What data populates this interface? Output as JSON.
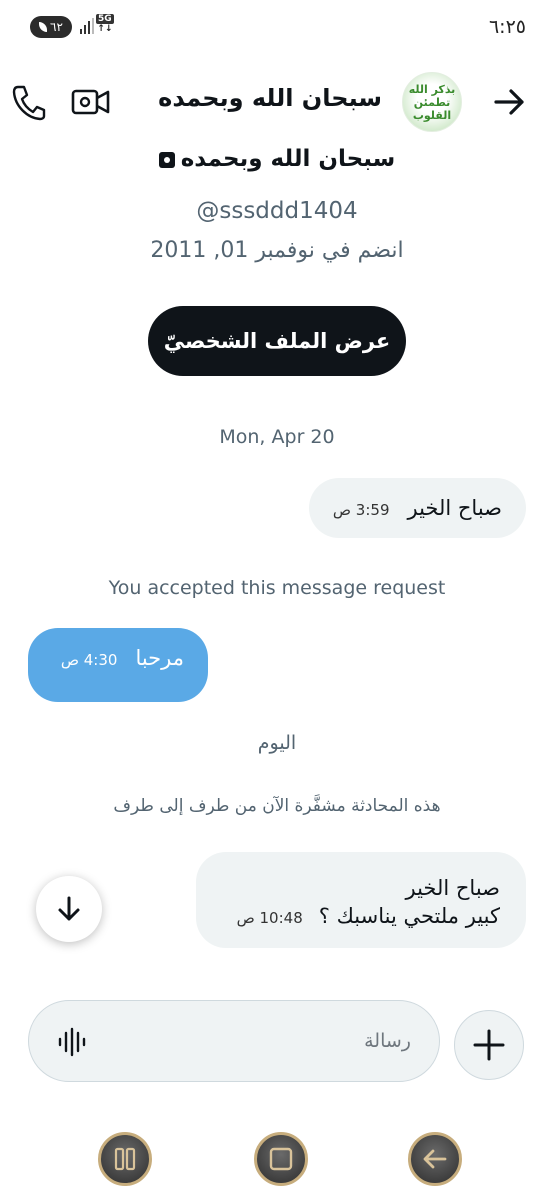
{
  "status_bar": {
    "time": "٦:٢٥",
    "battery_level": "٦٢",
    "network": "5G"
  },
  "header": {
    "title": "سبحان الله وبحمده",
    "avatar_text_line1": "بذكر الله",
    "avatar_text_line2": "تطمئن القلوب"
  },
  "profile": {
    "name": "سبحان الله وبحمده",
    "handle": "@sssddd1404",
    "joined": "انضم في نوفمبر 01, 2011",
    "view_profile_label": "عرض الملف الشخصيّ"
  },
  "conversation": {
    "date_1": "Mon, Apr 20",
    "msg1": {
      "text": "صباح الخير",
      "time": "3:59 ص"
    },
    "accepted_notice": "You accepted this message request",
    "msg2": {
      "text": "مرحبا",
      "time": "4:30 ص"
    },
    "date_2": "اليوم",
    "encryption_notice": "هذه المحادثة مشفَّرة الآن من طرف إلى طرف",
    "msg3": {
      "line1": "صباح الخير",
      "line2": "كبير ملتحي يناسبك ؟",
      "time": "10:48 ص"
    }
  },
  "composer": {
    "placeholder": "رسالة"
  },
  "icons": {
    "back": "arrow-right-icon",
    "video": "video-camera-icon",
    "phone": "phone-icon",
    "scroll_down": "arrow-down-icon",
    "voice": "audio-waveform-icon",
    "add": "plus-icon"
  }
}
